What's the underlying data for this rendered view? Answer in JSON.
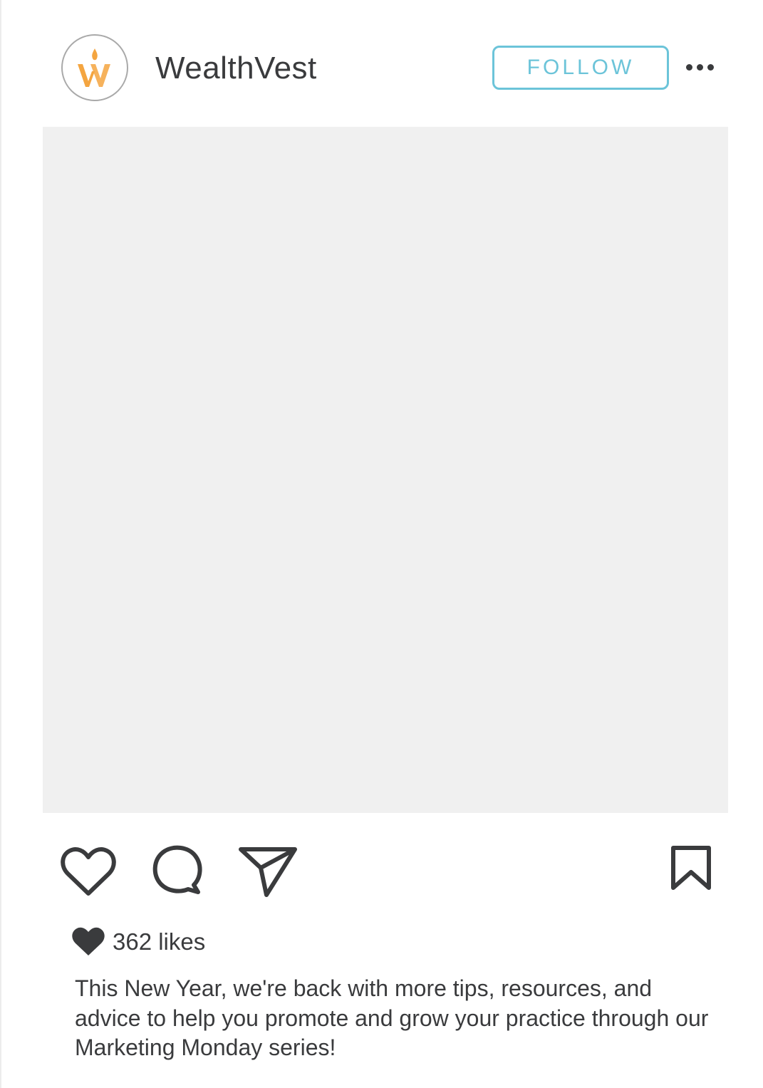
{
  "post": {
    "account": {
      "username": "WealthVest",
      "avatar_icon": "wealthvest-logo",
      "logo_color": "#f4a540",
      "avatar_letter": "W"
    },
    "follow_label": "FOLLOW",
    "follow_color": "#6cc4d9",
    "more_icon": "more-horizontal-icon",
    "image_placeholder_color": "#f0f0f0",
    "actions": {
      "like_icon": "heart-outline-icon",
      "comment_icon": "speech-bubble-icon",
      "share_icon": "paper-plane-icon",
      "save_icon": "bookmark-icon"
    },
    "likes_label": "362 likes",
    "caption": "This New Year, we're back with more tips, resources, and advice to help you promote and grow your practice through our Marketing Monday series!"
  }
}
